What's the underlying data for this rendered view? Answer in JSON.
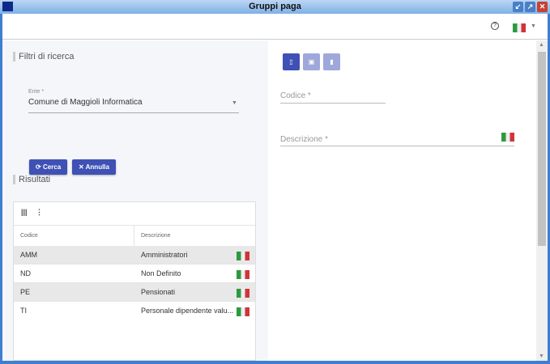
{
  "window": {
    "title": "Gruppi paga"
  },
  "header": {
    "help_icon": "?"
  },
  "filters": {
    "title": "Filtri di ricerca",
    "ente_label": "Ente *",
    "ente_value": "Comune di Maggioli Informatica",
    "search_label": "Cerca",
    "cancel_label": "Annulla"
  },
  "results": {
    "title": "Risultati",
    "columns": [
      "Codice",
      "Descrizione"
    ],
    "rows": [
      {
        "code": "AMM",
        "desc": "Amministratori"
      },
      {
        "code": "ND",
        "desc": "Non Definito"
      },
      {
        "code": "PE",
        "desc": "Pensionati"
      },
      {
        "code": "TI",
        "desc": "Personale dipendente valu..."
      }
    ]
  },
  "detail": {
    "codice_label": "Codice *",
    "descrizione_label": "Descrizione *"
  },
  "colors": {
    "primary": "#3f51b5",
    "primary_disabled": "#9fa8da"
  }
}
